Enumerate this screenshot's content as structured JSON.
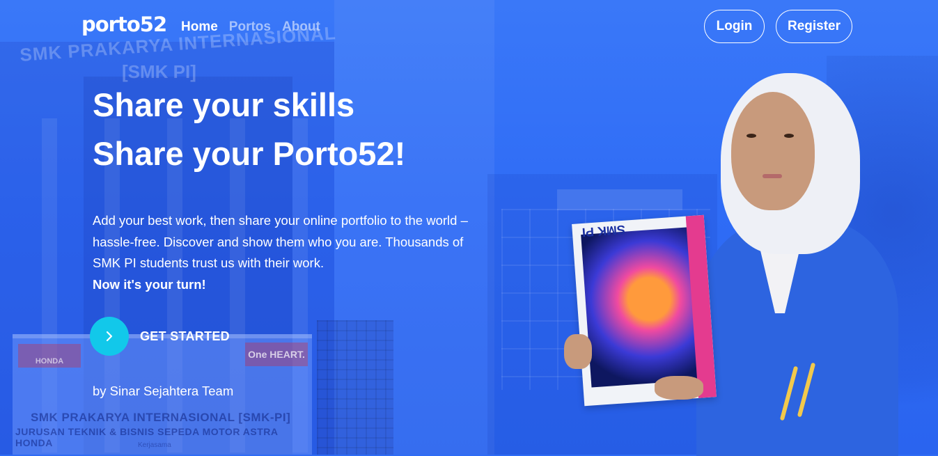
{
  "header": {
    "logo": "porto52",
    "nav": [
      {
        "label": "Home",
        "active": true
      },
      {
        "label": "Portos",
        "active": false
      },
      {
        "label": "About",
        "active": false
      }
    ],
    "login_label": "Login",
    "register_label": "Register"
  },
  "hero": {
    "title_line1": "Share your skills",
    "title_line2": "Share your Porto52!",
    "description": "Add your best work, then share your online portfolio to the world – hassle-free. Discover and show them who you are. Thousands of SMK PI students trust us with their work.",
    "description_emphasis": "Now it's your turn!",
    "cta_label": "GET STARTED",
    "cta_icon": "chevron-right-icon",
    "byline": "by Sinar Sejahtera Team"
  },
  "background": {
    "building_sign_line1": "SMK PRAKARYA INTERNASIONAL",
    "building_sign_line2": "[SMK PI]",
    "banner_brand": "HONDA",
    "banner_slogan": "One HEART.",
    "banner_line1": "SMK PRAKARYA INTERNASIONAL [SMK-PI]",
    "banner_line2": "JURUSAN TEKNIK & BISNIS SEPEDA MOTOR ASTRA HONDA",
    "banner_line3": "Kerjasama",
    "book_title": "SMK PI"
  },
  "colors": {
    "background": "#2f6cf5",
    "cta_circle": "#12c8ea",
    "text": "#ffffff",
    "nav_dim": "rgba(255,255,255,0.55)"
  }
}
